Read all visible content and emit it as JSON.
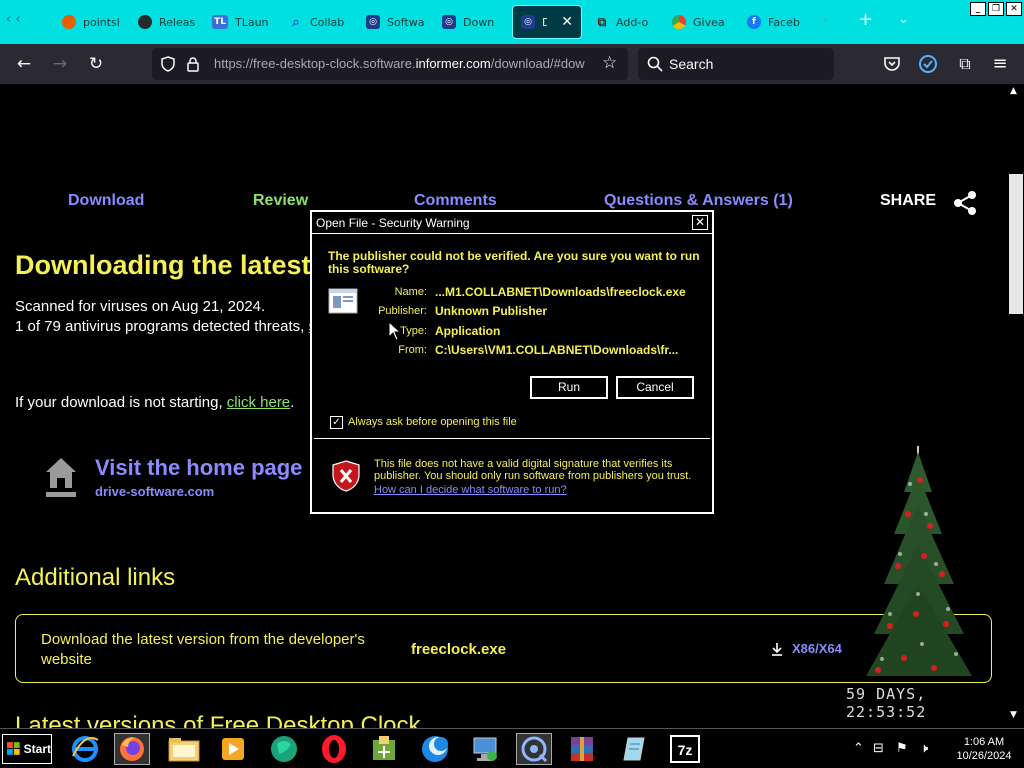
{
  "browser": {
    "tabs": [
      {
        "label": "pointsl",
        "favicon": "firefox-icon",
        "color": "#e66000"
      },
      {
        "label": "Releas",
        "favicon": "github-icon",
        "color": "#24292e"
      },
      {
        "label": "TLaun",
        "favicon": "tl-icon",
        "color": "#3b6fd6"
      },
      {
        "label": "Collab",
        "favicon": "search-icon",
        "color": "#2a5bd7"
      },
      {
        "label": "Softwa",
        "favicon": "informer-icon",
        "color": "#1e3c8c"
      },
      {
        "label": "Down",
        "favicon": "informer-icon",
        "color": "#1e3c8c"
      },
      {
        "label": "Dow",
        "favicon": "informer-icon",
        "color": "#1e3c8c",
        "active": true
      },
      {
        "label": "Add-o",
        "favicon": "puzzle-icon",
        "color": "#333"
      },
      {
        "label": "Givea",
        "favicon": "chrome-icon",
        "color": "#e34133"
      },
      {
        "label": "Faceb",
        "favicon": "facebook-icon",
        "color": "#1877f2"
      }
    ],
    "url_prefix": "https://free-desktop-clock.software.",
    "url_domain": "informer.com",
    "url_suffix": "/download/#dow",
    "search_label": "Search"
  },
  "page": {
    "menu": {
      "download": "Download",
      "review": "Review",
      "comments": "Comments",
      "qa": "Questions & Answers (1)",
      "share": "SHARE"
    },
    "heading": "Downloading the latest",
    "scan_line": "Scanned for viruses on Aug 21, 2024.",
    "detect_line": "1 of 79 antivirus programs detected threats,",
    "detect_link_fragment": "s",
    "not_starting": "If your download is not starting,",
    "click_here": "click here",
    "period": ".",
    "home_title": "Visit the home page",
    "home_sub": "drive-software.com",
    "additional_links": "Additional links",
    "dl_desc": "Download the latest version from the developer's website",
    "dl_file": "freeclock.exe",
    "dl_arch": "X86/X64",
    "countdown": "59 DAYS, 22:53:52",
    "latest_versions": "Latest versions of Free Desktop Clock"
  },
  "dialog": {
    "title": "Open File - Security Warning",
    "question": "The publisher could not be verified.  Are you sure you want to run this software?",
    "name_label": "Name:",
    "name_value": "...M1.COLLABNET\\Downloads\\freeclock.exe",
    "publisher_label": "Publisher:",
    "publisher_value": "Unknown Publisher",
    "type_label": "Type:",
    "type_value": "Application",
    "from_label": "From:",
    "from_value": "C:\\Users\\VM1.COLLABNET\\Downloads\\fr...",
    "run_label": "Run",
    "cancel_label": "Cancel",
    "always_ask": "Always ask before opening this file",
    "always_ask_checked": true,
    "warning": "This file does not have a valid digital signature that verifies its publisher.  You should only run software from publishers you trust.",
    "help_link": "How can I decide what software to run?"
  },
  "taskbar": {
    "start_label": "Start",
    "time": "1:06 AM",
    "date": "10/26/2024"
  },
  "colors": {
    "tabstrip": "#00e0e0",
    "yellow_text": "#f5f056",
    "link_blue": "#8b8bff",
    "green": "#8be36c"
  }
}
